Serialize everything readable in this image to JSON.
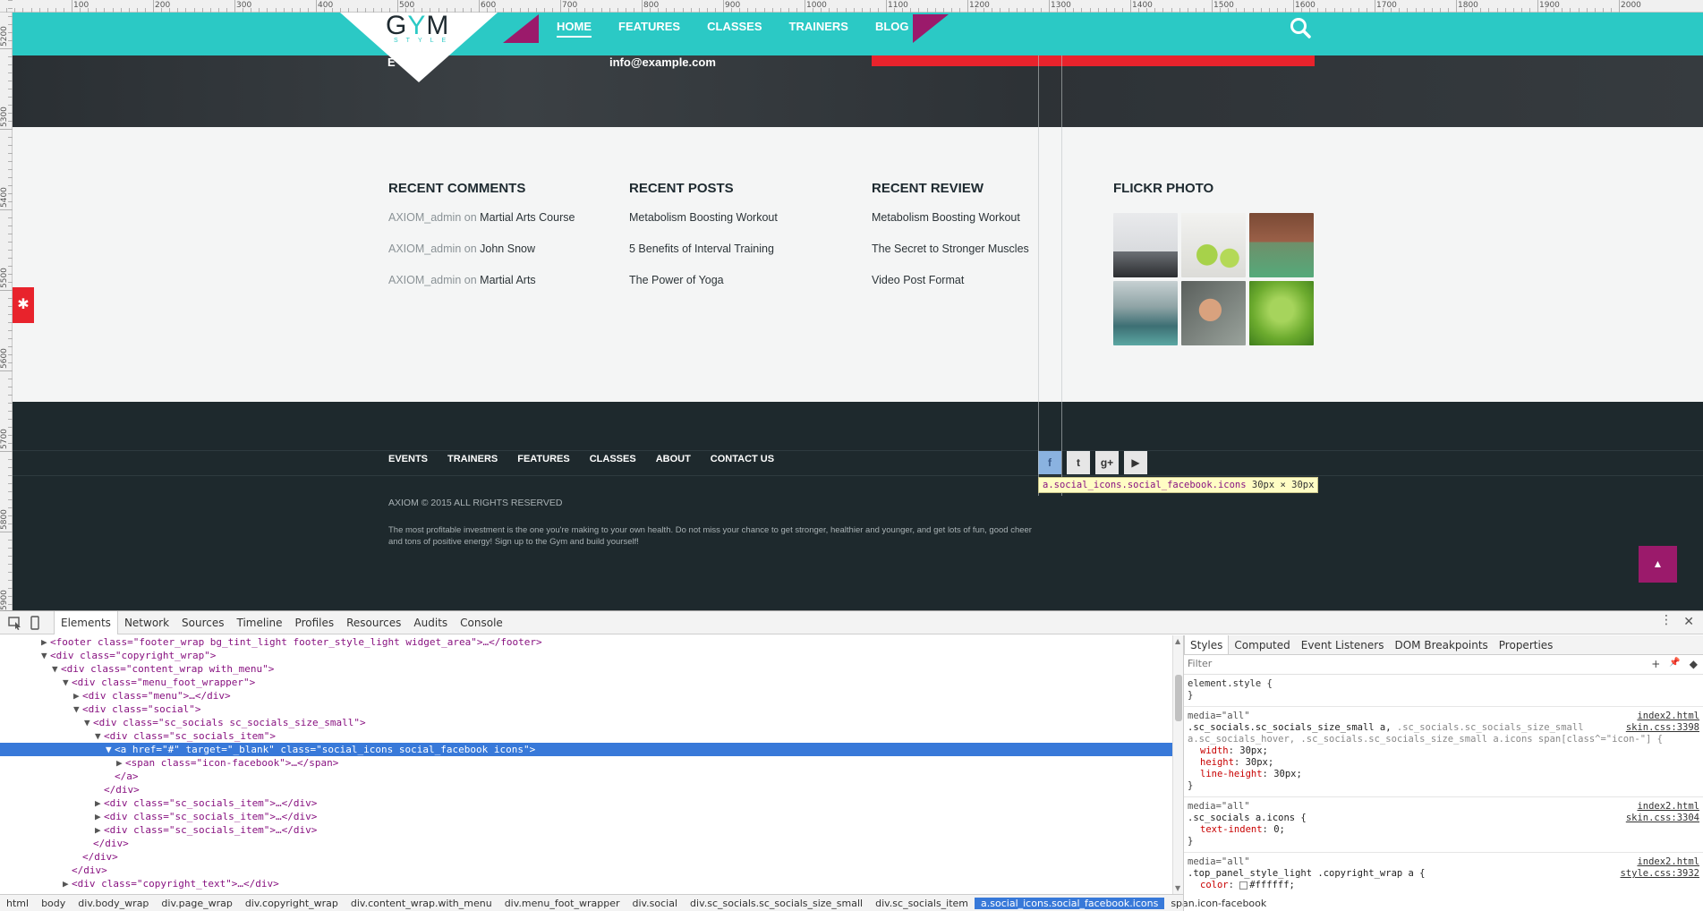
{
  "ruler": {
    "top_labels": [
      "100",
      "200",
      "300",
      "400",
      "500",
      "600",
      "700",
      "800",
      "900",
      "1000",
      "1100",
      "1200",
      "1300",
      "1400",
      "1500",
      "1600",
      "1700",
      "1800",
      "1900",
      "2000"
    ],
    "left_labels": [
      "5200",
      "5300",
      "5400",
      "5500",
      "5600",
      "5700",
      "5800",
      "5900"
    ]
  },
  "site": {
    "logo": {
      "text_g": "G",
      "text_y": "Y",
      "text_m": "M",
      "sub": "STYLE"
    },
    "nav": [
      {
        "label": "HOME",
        "active": true
      },
      {
        "label": "FEATURES",
        "active": false
      },
      {
        "label": "CLASSES",
        "active": false
      },
      {
        "label": "TRAINERS",
        "active": false
      },
      {
        "label": "BLOG",
        "active": false
      }
    ],
    "search_icon": "search-icon",
    "hero": {
      "email": "info@example.com",
      "fragment": "E"
    },
    "widgets": [
      {
        "title": "RECENT COMMENTS",
        "items": [
          {
            "author": "AXIOM_admin",
            "joiner": "on",
            "link": "Martial Arts Course"
          },
          {
            "author": "AXIOM_admin",
            "joiner": "on",
            "link": "John Snow"
          },
          {
            "author": "AXIOM_admin",
            "joiner": "on",
            "link": "Martial Arts"
          }
        ]
      },
      {
        "title": "RECENT POSTS",
        "items": [
          "Metabolism Boosting Workout",
          "5 Benefits of Interval Training",
          "The Power of Yoga"
        ]
      },
      {
        "title": "RECENT REVIEW",
        "items": [
          "Metabolism Boosting Workout",
          "The Secret to Stronger Muscles",
          "Video Post Format"
        ]
      },
      {
        "title": "FLICKR PHOTO",
        "items": []
      }
    ],
    "footer_menu": [
      "EVENTS",
      "TRAINERS",
      "FEATURES",
      "CLASSES",
      "ABOUT",
      "CONTACT US"
    ],
    "socials": [
      {
        "icon": "facebook-icon",
        "glyph": "f"
      },
      {
        "icon": "twitter-icon",
        "glyph": "t"
      },
      {
        "icon": "google-plus-icon",
        "glyph": "g+"
      },
      {
        "icon": "youtube-icon",
        "glyph": "▶"
      }
    ],
    "tooltip": {
      "selector": "a.social_icons.social_facebook.icons",
      "size": "30px × 30px"
    },
    "copyright": "AXIOM © 2015 ALL RIGHTS RESERVED",
    "about": "The most profitable investment is the one you're making to your own health. Do not miss your chance to get stronger, healthier and younger, and get lots of fun, good cheer and tons of positive energy! Sign up to the Gym and build yourself!",
    "colors": {
      "header": "#2bc9c5",
      "accent": "#9b1a6b",
      "red": "#e8232c",
      "footer": "#1e292d"
    }
  },
  "devtools": {
    "tabs": [
      "Elements",
      "Network",
      "Sources",
      "Timeline",
      "Profiles",
      "Resources",
      "Audits",
      "Console"
    ],
    "active_tab": "Elements",
    "dom_lines": [
      {
        "indent": 4,
        "tri": "▶",
        "html": "<footer class=\"footer_wrap bg_tint_light footer_style_light widget_area\">…</footer>"
      },
      {
        "indent": 4,
        "tri": "▼",
        "html": "<div class=\"copyright_wrap\">"
      },
      {
        "indent": 5,
        "tri": "▼",
        "html": "<div class=\"content_wrap with_menu\">"
      },
      {
        "indent": 6,
        "tri": "▼",
        "html": "<div class=\"menu_foot_wrapper\">"
      },
      {
        "indent": 7,
        "tri": "▶",
        "html": "<div class=\"menu\">…</div>"
      },
      {
        "indent": 7,
        "tri": "▼",
        "html": "<div class=\"social\">"
      },
      {
        "indent": 8,
        "tri": "▼",
        "html": "<div class=\"sc_socials sc_socials_size_small\">"
      },
      {
        "indent": 9,
        "tri": "▼",
        "html": "<div class=\"sc_socials_item\">"
      },
      {
        "indent": 10,
        "tri": "▼",
        "html": "<a href=\"#\" target=\"_blank\" class=\"social_icons social_facebook icons\">",
        "selected": true
      },
      {
        "indent": 11,
        "tri": "▶",
        "html": "<span class=\"icon-facebook\">…</span>"
      },
      {
        "indent": 10,
        "tri": "",
        "html": "</a>"
      },
      {
        "indent": 9,
        "tri": "",
        "html": "</div>"
      },
      {
        "indent": 9,
        "tri": "▶",
        "html": "<div class=\"sc_socials_item\">…</div>"
      },
      {
        "indent": 9,
        "tri": "▶",
        "html": "<div class=\"sc_socials_item\">…</div>"
      },
      {
        "indent": 9,
        "tri": "▶",
        "html": "<div class=\"sc_socials_item\">…</div>"
      },
      {
        "indent": 8,
        "tri": "",
        "html": "</div>"
      },
      {
        "indent": 7,
        "tri": "",
        "html": "</div>"
      },
      {
        "indent": 6,
        "tri": "",
        "html": "</div>"
      },
      {
        "indent": 6,
        "tri": "▶",
        "html": "<div class=\"copyright_text\">…</div>"
      }
    ],
    "breadcrumb": [
      "html",
      "body",
      "div.body_wrap",
      "div.page_wrap",
      "div.copyright_wrap",
      "div.content_wrap.with_menu",
      "div.menu_foot_wrapper",
      "div.social",
      "div.sc_socials.sc_socials_size_small",
      "div.sc_socials_item",
      "a.social_icons.social_facebook.icons",
      "span.icon-facebook"
    ],
    "breadcrumb_active": "a.social_icons.social_facebook.icons",
    "styles_tabs": [
      "Styles",
      "Computed",
      "Event Listeners",
      "DOM Breakpoints",
      "Properties"
    ],
    "styles_active": "Styles",
    "filter_placeholder": "Filter",
    "filter_actions": [
      "+",
      "📌",
      "◆"
    ],
    "rules": {
      "element_style": {
        "selector": "element.style {",
        "close": "}"
      },
      "rule1": {
        "media": "media=\"all\"",
        "selector_a": ".sc_socials.sc_socials_size_small a,",
        "selector_b": ".sc_socials.sc_socials_size_small",
        "selector_c": "a.sc_socials_hover, .sc_socials.sc_socials_size_small a.icons span[class^=\"icon-\"] {",
        "src1": "index2.html",
        "src2": "skin.css:3398",
        "props": [
          {
            "name": "width",
            "value": "30px;"
          },
          {
            "name": "height",
            "value": "30px;"
          },
          {
            "name": "line-height",
            "value": "30px;"
          }
        ],
        "close": "}"
      },
      "rule2": {
        "media": "media=\"all\"",
        "selector": ".sc_socials a.icons {",
        "src1": "index2.html",
        "src2": "skin.css:3304",
        "props": [
          {
            "name": "text-indent",
            "value": "0;"
          }
        ],
        "close": "}"
      },
      "rule3": {
        "media": "media=\"all\"",
        "selector": ".top_panel_style_light .copyright_wrap a {",
        "src1": "index2.html",
        "src2": "style.css:3932",
        "props": [
          {
            "name": "color",
            "value": "#ffffff;"
          }
        ]
      }
    }
  }
}
